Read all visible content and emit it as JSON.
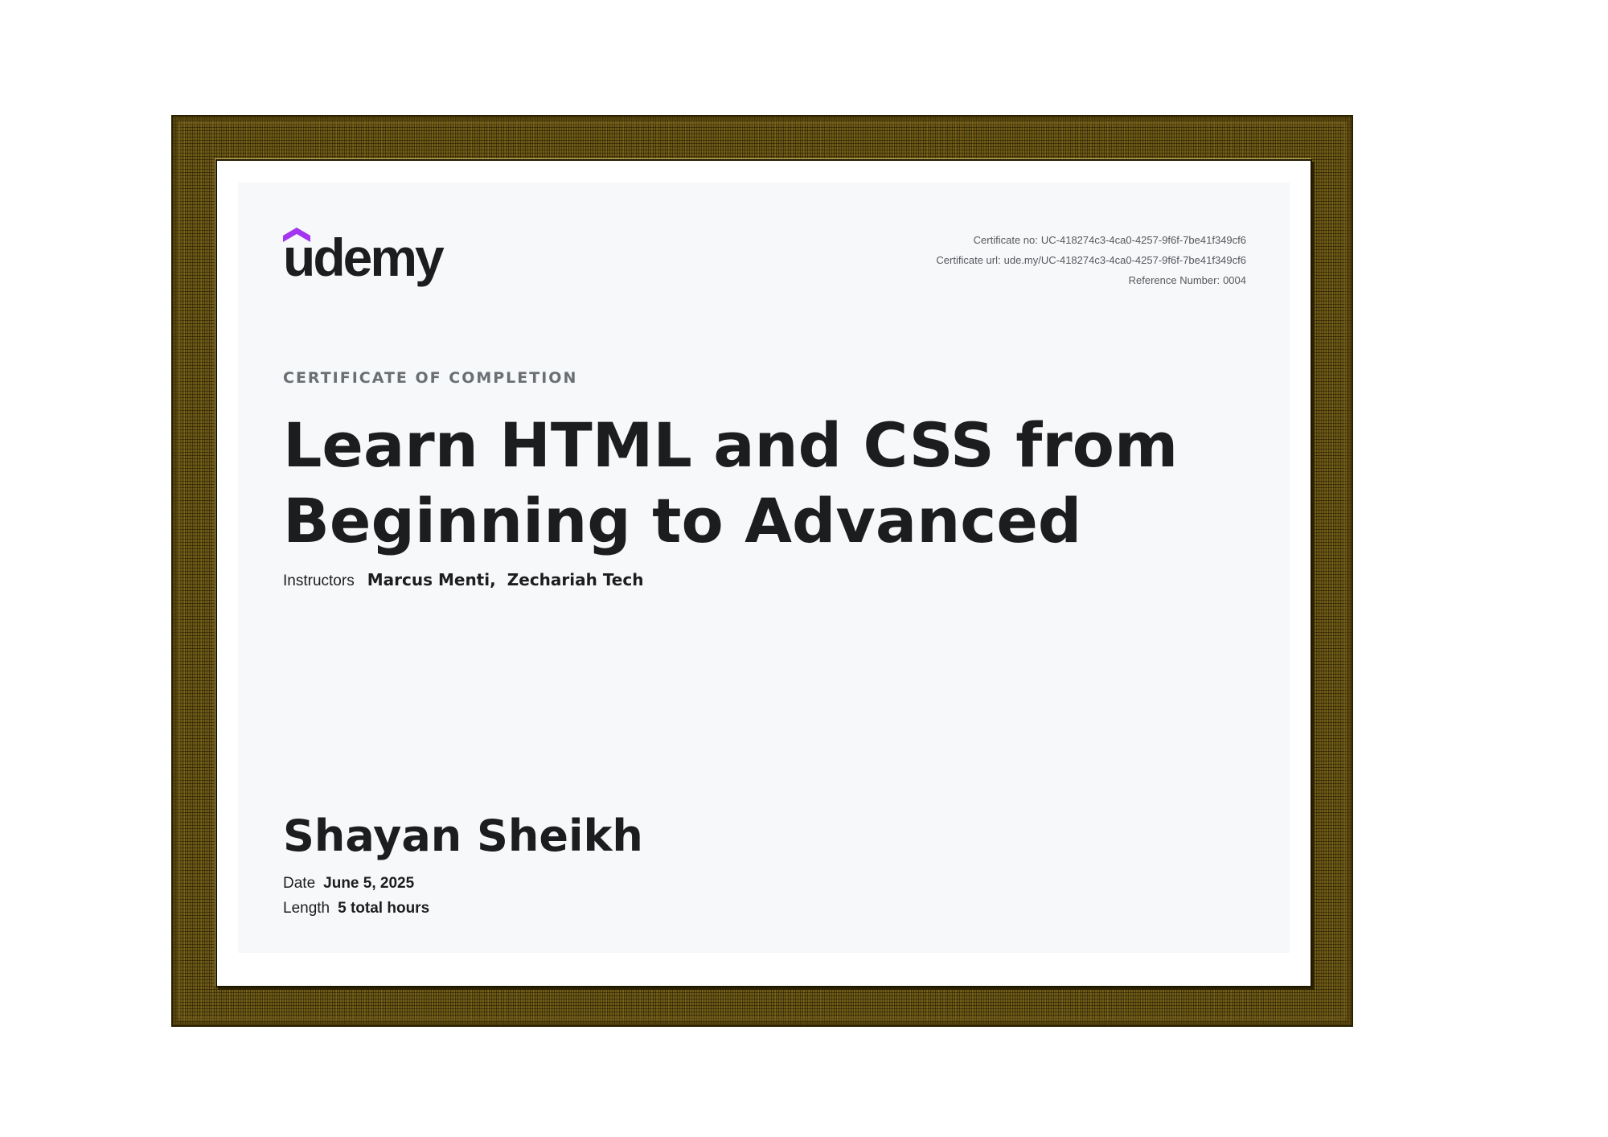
{
  "brand": {
    "name": "udemy",
    "mark_color": "#a435f0"
  },
  "certificate": {
    "number_label": "Certificate no:",
    "number": "UC-418274c3-4ca0-4257-9f6f-7be41f349cf6",
    "url_label": "Certificate url:",
    "url": "ude.my/UC-418274c3-4ca0-4257-9f6f-7be41f349cf6",
    "reference_label": "Reference Number:",
    "reference": "0004",
    "eyebrow": "CERTIFICATE OF COMPLETION"
  },
  "course": {
    "title": "Learn HTML and CSS from Beginning to Advanced",
    "instructors_label": "Instructors",
    "instructors": [
      "Marcus Menti,",
      "Zechariah Tech"
    ]
  },
  "recipient": {
    "name": "Shayan Sheikh"
  },
  "details": {
    "date_label": "Date",
    "date": "June 5, 2025",
    "length_label": "Length",
    "length": "5 total hours"
  },
  "colors": {
    "frame_gold": "#6e5a16",
    "paper": "#f7f8fa",
    "text": "#1c1d1f",
    "muted": "#6a6f73"
  }
}
